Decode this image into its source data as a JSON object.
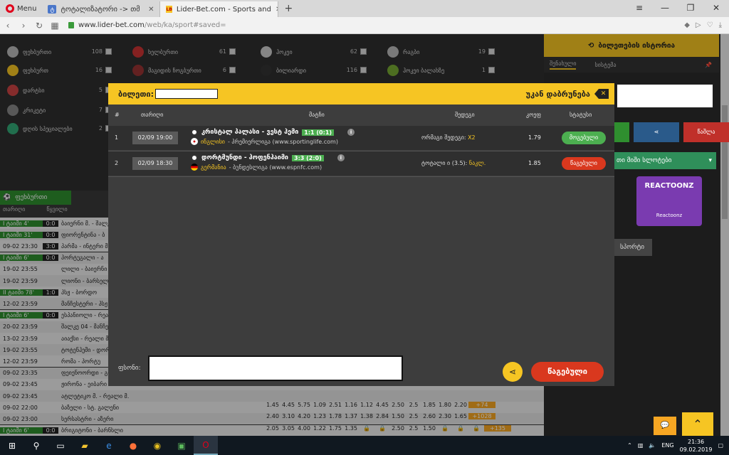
{
  "browser": {
    "menu_label": "Menu",
    "tabs": [
      {
        "title": "ტოტალიზატორი -> თმ"
      },
      {
        "title": "Lider-Bet.com - Sports and"
      }
    ],
    "new_tab_icon": "+",
    "url_domain": "www.lider-bet.com",
    "url_path": "/web/ka/sport#saved="
  },
  "sports_menu": [
    {
      "name": "ფეხბურთი",
      "count": "108"
    },
    {
      "name": "ფეხბურთ",
      "count": "16"
    },
    {
      "name": "დარტსი",
      "count": "5"
    },
    {
      "name": "კრიკეტი",
      "count": "7"
    },
    {
      "name": "დღის სპეციალები",
      "count": "2"
    },
    {
      "name": "ხელბურთი",
      "count": "61"
    },
    {
      "name": "მაგიდის ჩოგბურთი",
      "count": "6"
    },
    {
      "name": "ჰოკეი",
      "count": "62"
    },
    {
      "name": "ბილიარდი",
      "count": "116"
    },
    {
      "name": "რაგბი",
      "count": "19"
    },
    {
      "name": "ჰოკეი ბალახზე",
      "count": "1"
    }
  ],
  "right_panel": {
    "ticket_history": "ბილეთების ისტორია",
    "tab_saved": "შენახული",
    "tab_system": "სისტემა",
    "btn_delete": "წაშლა",
    "slots_title": "თი მიში სლოტები",
    "game_title": "REACTOONZ",
    "game_sub": "Reactoonz",
    "sports_tab": "სპორტი"
  },
  "left_table": {
    "tab_label": "ფეხბურთი",
    "col_date": "თარიღი",
    "col_pair": "წყვილი",
    "rows": [
      {
        "time": "I ტაიმი 4'",
        "score": "0:0",
        "team": "ბაიერნი მ. - შალკე",
        "live": true
      },
      {
        "time": "I ტაიმი 31'",
        "score": "0:0",
        "team": "ფიორენტინა - ბ",
        "live": true
      },
      {
        "time": "09-02 23:30",
        "score": "3:0",
        "team": "პარმა - ინტერი მ.",
        "live": false
      },
      {
        "time": "I ტაიმი 6'",
        "score": "0:0",
        "team": "პორტუგალი - ა",
        "live": true
      },
      {
        "time": "19-02 23:55",
        "score": "",
        "team": "ლილი - ბაიერნი",
        "live": false
      },
      {
        "time": "19-02 23:59",
        "score": "",
        "team": "ლიონი - ბარსელონა",
        "live": false
      },
      {
        "time": "II ტაიმი 78'",
        "score": "1:0",
        "team": "პსჟ - ბორდო",
        "live": true
      },
      {
        "time": "12-02 23:59",
        "score": "",
        "team": "მანჩესტერი - პსჟ",
        "live": false
      },
      {
        "time": "I ტაიმი 6'",
        "score": "0:0",
        "team": "ესპანიოლი - რეალ",
        "live": true
      },
      {
        "time": "20-02 23:59",
        "score": "",
        "team": "შალკე 04 - მანჩესტერი",
        "live": false
      },
      {
        "time": "13-02 23:59",
        "score": "",
        "team": "აიაქსი - რეალი მ.",
        "live": false
      },
      {
        "time": "19-02 23:55",
        "score": "",
        "team": "ტოტენჰემი - დორტმუნდი",
        "live": false
      },
      {
        "time": "12-02 23:59",
        "score": "",
        "team": "რომა - პორტუ",
        "live": false
      },
      {
        "time": "09-02 23:35",
        "score": "",
        "team": "ფეიენოორდი - გრონინგენი",
        "live": false
      },
      {
        "time": "09-02 23:45",
        "score": "",
        "team": "ჟირონა - ეიბარი",
        "live": false
      },
      {
        "time": "09-02 23:45",
        "score": "",
        "team": "ატლეტიკო მ. - რეალი მ.",
        "live": false
      },
      {
        "time": "09-02 22:00",
        "score": "",
        "team": "ბაზელი - სტ. გალენი",
        "live": false
      },
      {
        "time": "09-02 23:00",
        "score": "",
        "team": "სერსასტრი - აზერი",
        "live": false
      },
      {
        "time": "I ტაიმი 6'",
        "score": "0:0",
        "team": "ბრიგიტონი - ბარნსლი",
        "live": true
      },
      {
        "time": "II ტაიმი 77'",
        "score": "2:0",
        "team": "ბენფიკა - სპორტინგი",
        "live": true
      },
      {
        "time": "II ტაიმი 72'",
        "score": "0:1",
        "team": "ბოლონია - ლაციო",
        "live": true
      }
    ],
    "odds_rows": [
      {
        "vals": [
          "1.45",
          "4.45",
          "5.75",
          "1.09",
          "2.51",
          "1.16",
          "1.12",
          "4.45",
          "2.50",
          "2.5",
          "1.85",
          "1.80",
          "2.20"
        ],
        "plus": "+74"
      },
      {
        "vals": [
          "2.40",
          "3.10",
          "4.20",
          "1.23",
          "1.78",
          "1.37",
          "1.38",
          "2.84",
          "1.50",
          "2.5",
          "2.60",
          "2.30",
          "1.65"
        ],
        "plus": "+1028"
      },
      {
        "vals": [
          "2.05",
          "3.05",
          "4.00",
          "1.22",
          "1.75",
          "1.35",
          "",
          "",
          "2.50",
          "2.5",
          "1.50",
          "",
          "",
          ""
        ],
        "plus": "+135"
      },
      {
        "vals": [
          "",
          "",
          "",
          "",
          "",
          "",
          "",
          "",
          "1.65",
          "2.5",
          "2.15",
          "",
          "",
          ""
        ],
        "plus": "+25"
      }
    ]
  },
  "modal": {
    "ticket_label": "ბილეთი:",
    "back_label": "უკან დაბრუნება",
    "cols": {
      "num": "#",
      "date": "თარიღი",
      "match": "მატჩი",
      "outcome": "შედეგი",
      "odd": "კოეფ",
      "status": "სტატუსი"
    },
    "bets": [
      {
        "num": "1",
        "date": "02/09 19:00",
        "match": "კრისტალ პალასი - ვესტ ჰემი",
        "score": "1:1 (0:1)",
        "country": "ინგლისი",
        "league": "- პრემიერლიგა (www.sportinglife.com)",
        "bet_type": "ორმაგი შედეგი:",
        "selection": "X2",
        "odd": "1.79",
        "status": "მოგებული",
        "status_kind": "win"
      },
      {
        "num": "2",
        "date": "02/09 18:30",
        "match": "დორტმუნდი - ჰოფენჰაიმი",
        "score": "3:3 (2:0)",
        "country": "გერმანია",
        "league": "- ბუნდესლიგა (www.espnfc.com)",
        "bet_type": "ტოტალი ი (3.5):",
        "selection": "ნაკლ.",
        "odd": "1.85",
        "status": "წაგებული",
        "status_kind": "lose"
      }
    ],
    "pin_label": "ფსონი:",
    "final_status": "წაგებული"
  },
  "taskbar": {
    "lang": "ENG",
    "time": "21:36",
    "date": "09.02.2019"
  },
  "colors": {
    "accent": "#f6c523",
    "win": "#4caf50",
    "lose": "#d9381e",
    "live": "#2f8f2f"
  }
}
